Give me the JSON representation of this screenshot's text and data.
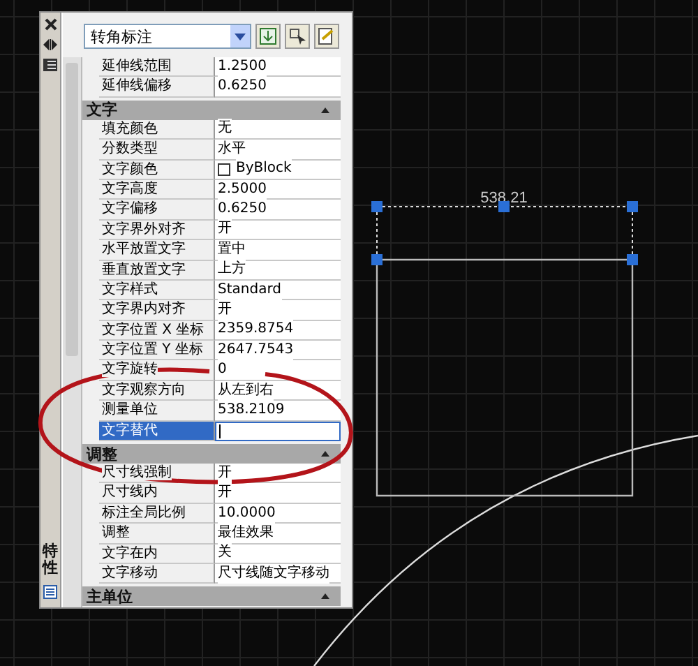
{
  "palette": {
    "side_title": "特性",
    "object_type": "转角标注",
    "sections": [
      {
        "rows": [
          {
            "name": "延伸线范围",
            "value": "1.2500",
            "kind": "text",
            "selected": false
          },
          {
            "name": "延伸线偏移",
            "value": "0.6250",
            "kind": "text",
            "selected": false
          }
        ]
      },
      {
        "title": "文字",
        "rows": [
          {
            "name": "填充颜色",
            "value": "无",
            "kind": "text",
            "selected": false
          },
          {
            "name": "分数类型",
            "value": "水平",
            "kind": "text",
            "selected": false
          },
          {
            "name": "文字颜色",
            "value": "ByBlock",
            "kind": "color",
            "selected": false
          },
          {
            "name": "文字高度",
            "value": "2.5000",
            "kind": "text",
            "selected": false
          },
          {
            "name": "文字偏移",
            "value": "0.6250",
            "kind": "text",
            "selected": false
          },
          {
            "name": "文字界外对齐",
            "value": "开",
            "kind": "text",
            "selected": false
          },
          {
            "name": "水平放置文字",
            "value": "置中",
            "kind": "text",
            "selected": false
          },
          {
            "name": "垂直放置文字",
            "value": "上方",
            "kind": "text",
            "selected": false
          },
          {
            "name": "文字样式",
            "value": "Standard",
            "kind": "text",
            "selected": false
          },
          {
            "name": "文字界内对齐",
            "value": "开",
            "kind": "text",
            "selected": false
          },
          {
            "name": "文字位置 X 坐标",
            "value": "2359.8754",
            "kind": "text",
            "selected": false
          },
          {
            "name": "文字位置 Y 坐标",
            "value": "2647.7543",
            "kind": "text",
            "selected": false
          },
          {
            "name": "文字旋转",
            "value": "0",
            "kind": "text",
            "selected": false
          },
          {
            "name": "文字观察方向",
            "value": "从左到右",
            "kind": "text",
            "selected": false
          },
          {
            "name": "测量单位",
            "value": "538.2109",
            "kind": "text",
            "selected": false
          },
          {
            "name": "文字替代",
            "value": "",
            "kind": "input",
            "selected": true
          }
        ]
      },
      {
        "title": "调整",
        "rows": [
          {
            "name": "尺寸线强制",
            "value": "开",
            "kind": "text",
            "selected": false
          },
          {
            "name": "尺寸线内",
            "value": "开",
            "kind": "text",
            "selected": false
          },
          {
            "name": "标注全局比例",
            "value": "10.0000",
            "kind": "text",
            "selected": false
          },
          {
            "name": "调整",
            "value": "最佳效果",
            "kind": "text",
            "selected": false
          },
          {
            "name": "文字在内",
            "value": "关",
            "kind": "text",
            "selected": false
          },
          {
            "name": "文字移动",
            "value": "尺寸线随文字移动",
            "kind": "text",
            "selected": false
          }
        ]
      },
      {
        "title": "主单位"
      }
    ]
  },
  "drawing": {
    "dimension_text": "538.21"
  }
}
